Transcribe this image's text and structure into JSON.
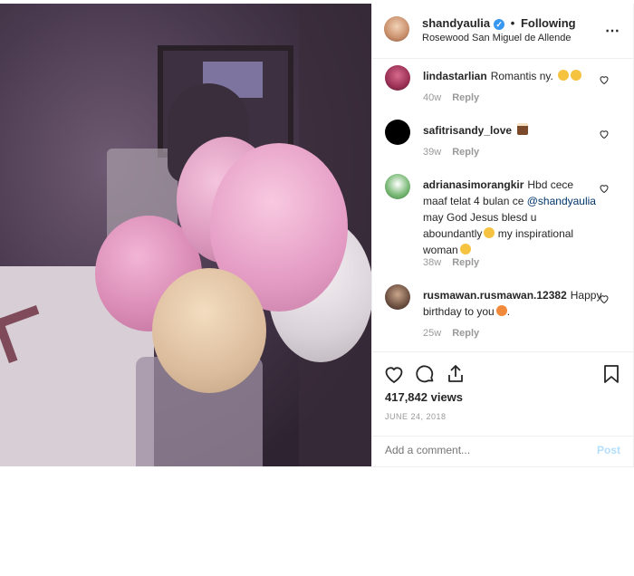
{
  "header": {
    "username": "shandyaulia",
    "verified_icon": "verified-badge-icon",
    "separator": "•",
    "follow_status": "Following",
    "location": "Rosewood San Miguel de Allende",
    "more_icon": "more-options-icon"
  },
  "comments": [
    {
      "username": "lindastarlian",
      "text": "Romantis ny.",
      "age": "40w",
      "reply": "Reply"
    },
    {
      "username": "safitrisandy_love",
      "text": "",
      "age": "39w",
      "reply": "Reply"
    },
    {
      "username": "adrianasimorangkir",
      "text_before": "Hbd cece maaf telat 4 bulan ce ",
      "mention": "@shandyaulia",
      "text_middle": " may God Jesus blesd u aboundantly",
      "text_end": " my inspirational woman",
      "age": "38w",
      "reply": "Reply"
    },
    {
      "username": "rusmawan.rusmawan.12382",
      "text": "Happy birthday to you",
      "text_tail": ".",
      "age": "25w",
      "reply": "Reply"
    }
  ],
  "actions": {
    "views": "417,842 views",
    "date": "JUNE 24, 2018",
    "comment_placeholder": "Add a comment...",
    "post_label": "Post"
  },
  "colors": {
    "link_blue": "#3897f0",
    "post_disabled": "#b2dffc",
    "muted": "#999999"
  }
}
